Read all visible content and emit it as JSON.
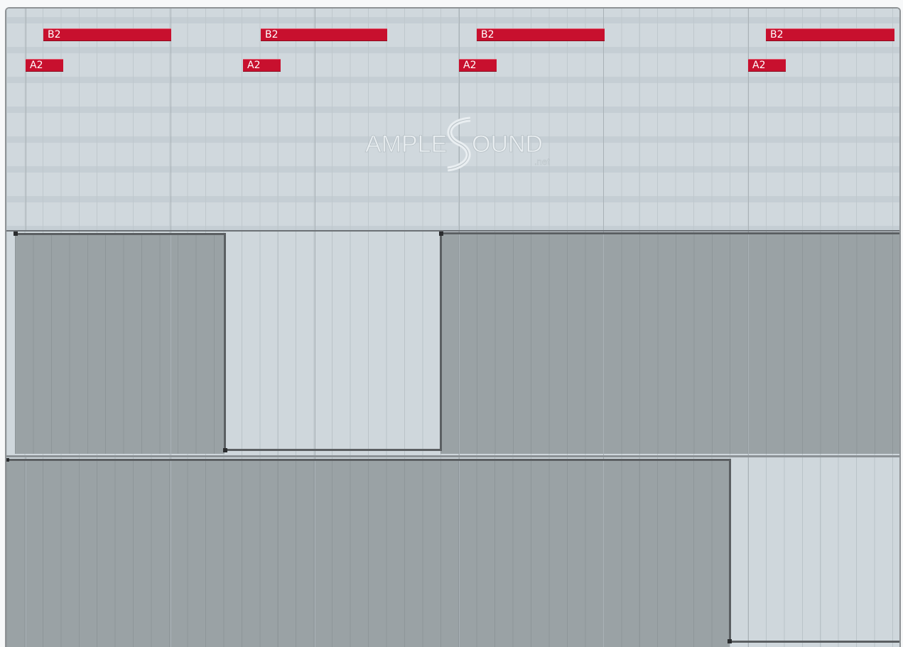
{
  "piano_roll": {
    "notes": [
      {
        "pitch": "B2"
      },
      {
        "pitch": "B2"
      },
      {
        "pitch": "B2"
      },
      {
        "pitch": "B2"
      },
      {
        "pitch": "A2"
      },
      {
        "pitch": "A2"
      },
      {
        "pitch": "A2"
      },
      {
        "pitch": "A2"
      }
    ],
    "note_color": "#c8102e"
  },
  "watermark": {
    "text_left": "AMPLE",
    "text_right": "OUND",
    "suffix": ".net"
  },
  "automation": {
    "lane_fill_color": "#9aa2a5",
    "lane_bg_color": "#cfd7dc",
    "line_color": "#5b5f62"
  }
}
